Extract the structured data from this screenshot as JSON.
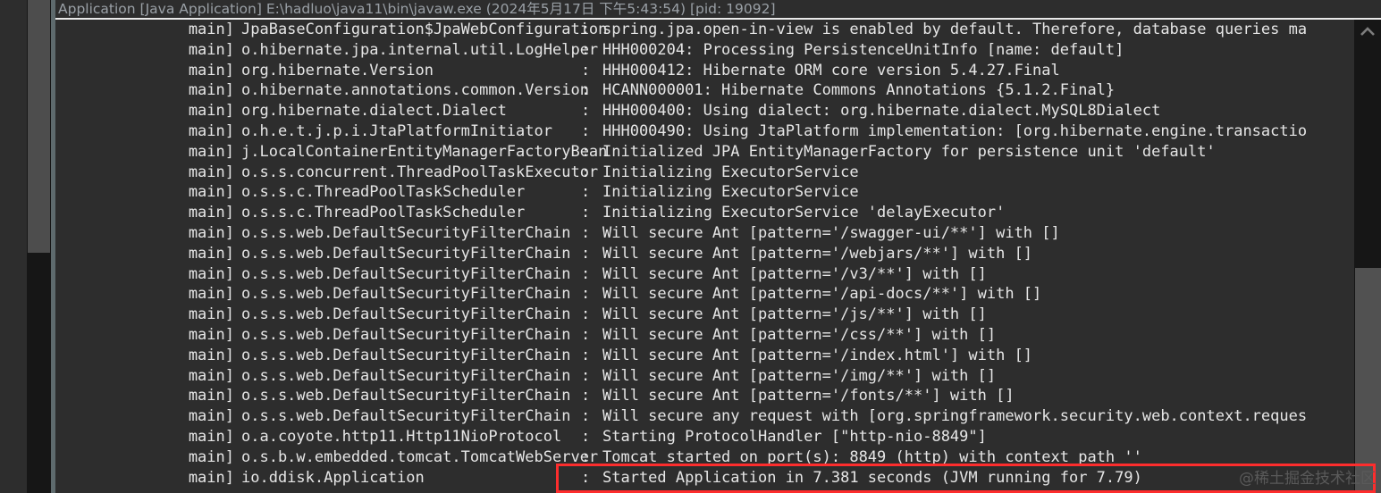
{
  "window": {
    "title": "Application [Java Application] E:\\hadluo\\java11\\bin\\javaw.exe  (2024年5月17日 下午5:43:54) [pid: 19092]"
  },
  "icons": {
    "scroll_up": "▲"
  },
  "colors": {
    "console_bg": "#2d2d2d",
    "text": "#e6e6e6",
    "title_text": "#9aa0a6",
    "scrollbar_track": "#161616",
    "scrollbar_thumb": "#515151",
    "annotation_red": "#fd2d2d",
    "watermark": "#5a5a5a"
  },
  "watermark": {
    "text": "@稀土掘金技术社区"
  },
  "console": {
    "lines": [
      {
        "thread": "main]",
        "logger": "JpaBaseConfiguration$JpaWebConfiguration",
        "sep": ":",
        "message": "spring.jpa.open-in-view is enabled by default. Therefore, database queries ma"
      },
      {
        "thread": "main]",
        "logger": "o.hibernate.jpa.internal.util.LogHelper",
        "sep": ":",
        "message": "HHH000204: Processing PersistenceUnitInfo [name: default]"
      },
      {
        "thread": "main]",
        "logger": "org.hibernate.Version",
        "sep": ":",
        "message": "HHH000412: Hibernate ORM core version 5.4.27.Final"
      },
      {
        "thread": "main]",
        "logger": "o.hibernate.annotations.common.Version",
        "sep": ":",
        "message": "HCANN000001: Hibernate Commons Annotations {5.1.2.Final}"
      },
      {
        "thread": "main]",
        "logger": "org.hibernate.dialect.Dialect",
        "sep": ":",
        "message": "HHH000400: Using dialect: org.hibernate.dialect.MySQL8Dialect"
      },
      {
        "thread": "main]",
        "logger": "o.h.e.t.j.p.i.JtaPlatformInitiator",
        "sep": ":",
        "message": "HHH000490: Using JtaPlatform implementation: [org.hibernate.engine.transactio"
      },
      {
        "thread": "main]",
        "logger": "j.LocalContainerEntityManagerFactoryBean",
        "sep": ":",
        "message": "Initialized JPA EntityManagerFactory for persistence unit 'default'"
      },
      {
        "thread": "main]",
        "logger": "o.s.s.concurrent.ThreadPoolTaskExecutor",
        "sep": ":",
        "message": "Initializing ExecutorService"
      },
      {
        "thread": "main]",
        "logger": "o.s.s.c.ThreadPoolTaskScheduler",
        "sep": ":",
        "message": "Initializing ExecutorService"
      },
      {
        "thread": "main]",
        "logger": "o.s.s.c.ThreadPoolTaskScheduler",
        "sep": ":",
        "message": "Initializing ExecutorService 'delayExecutor'"
      },
      {
        "thread": "main]",
        "logger": "o.s.s.web.DefaultSecurityFilterChain",
        "sep": ":",
        "message": "Will secure Ant [pattern='/swagger-ui/**'] with []"
      },
      {
        "thread": "main]",
        "logger": "o.s.s.web.DefaultSecurityFilterChain",
        "sep": ":",
        "message": "Will secure Ant [pattern='/webjars/**'] with []"
      },
      {
        "thread": "main]",
        "logger": "o.s.s.web.DefaultSecurityFilterChain",
        "sep": ":",
        "message": "Will secure Ant [pattern='/v3/**'] with []"
      },
      {
        "thread": "main]",
        "logger": "o.s.s.web.DefaultSecurityFilterChain",
        "sep": ":",
        "message": "Will secure Ant [pattern='/api-docs/**'] with []"
      },
      {
        "thread": "main]",
        "logger": "o.s.s.web.DefaultSecurityFilterChain",
        "sep": ":",
        "message": "Will secure Ant [pattern='/js/**'] with []"
      },
      {
        "thread": "main]",
        "logger": "o.s.s.web.DefaultSecurityFilterChain",
        "sep": ":",
        "message": "Will secure Ant [pattern='/css/**'] with []"
      },
      {
        "thread": "main]",
        "logger": "o.s.s.web.DefaultSecurityFilterChain",
        "sep": ":",
        "message": "Will secure Ant [pattern='/index.html'] with []"
      },
      {
        "thread": "main]",
        "logger": "o.s.s.web.DefaultSecurityFilterChain",
        "sep": ":",
        "message": "Will secure Ant [pattern='/img/**'] with []"
      },
      {
        "thread": "main]",
        "logger": "o.s.s.web.DefaultSecurityFilterChain",
        "sep": ":",
        "message": "Will secure Ant [pattern='/fonts/**'] with []"
      },
      {
        "thread": "main]",
        "logger": "o.s.s.web.DefaultSecurityFilterChain",
        "sep": ":",
        "message": "Will secure any request with [org.springframework.security.web.context.reques"
      },
      {
        "thread": "main]",
        "logger": "o.a.coyote.http11.Http11NioProtocol",
        "sep": ":",
        "message": "Starting ProtocolHandler [\"http-nio-8849\"]"
      },
      {
        "thread": "main]",
        "logger": "o.s.b.w.embedded.tomcat.TomcatWebServer",
        "sep": ":",
        "message": "Tomcat started on port(s): 8849 (http) with context path ''"
      },
      {
        "thread": "main]",
        "logger": "io.ddisk.Application",
        "sep": ":",
        "message": "Started Application in 7.381 seconds (JVM running for 7.79)"
      }
    ]
  }
}
